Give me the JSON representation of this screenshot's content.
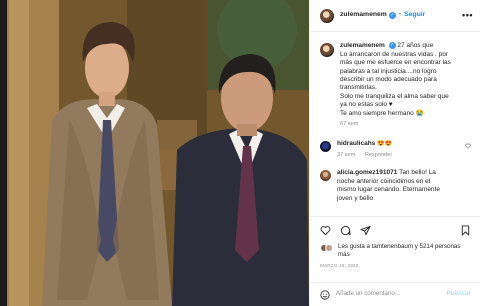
{
  "post": {
    "username": "zulemamenem",
    "follow_label": "Seguir",
    "dot": "•",
    "more": "•••",
    "caption_lines": [
      "27 años que",
      "Lo arrancaron de nuestras vidas . por",
      "más que me esfuerce en encontrar las",
      "palabras a tal injusticia....no logro",
      "describir un modo adecuado para",
      "transmitirlas.",
      "Solo me tranquiliza el alma saber que",
      "ya no estas solo ♥",
      "Te amo siempre hermano 😭"
    ],
    "caption_age": "67 sem"
  },
  "comments": [
    {
      "username": "hidraulicahs",
      "text": "😍😍",
      "age": "37 sem",
      "reply_label": "Responder"
    },
    {
      "username": "alicia.gomez191071",
      "text_lines": [
        "Tan bello! La",
        "noche anterior coincidimos en el",
        "mismo lugar cenando. Eternamente",
        "joven y bello"
      ]
    }
  ],
  "likes": {
    "text": "Les gusta a tamtenenbaum y 5214 personas más"
  },
  "date": "MARZO 15, 2022",
  "add_comment": {
    "placeholder": "Añade un comentario...",
    "publish_label": "Publicar"
  },
  "colors": {
    "link_blue": "#0095f6",
    "verified_blue": "#3897f0",
    "muted_gray": "#8e8e8e",
    "publish_disabled": "#b2dffc"
  },
  "icons": {
    "verified": "verified-badge-icon",
    "like": "heart-icon",
    "comment": "comment-icon",
    "share": "share-icon",
    "save": "bookmark-icon",
    "emoji": "smiley-icon"
  }
}
